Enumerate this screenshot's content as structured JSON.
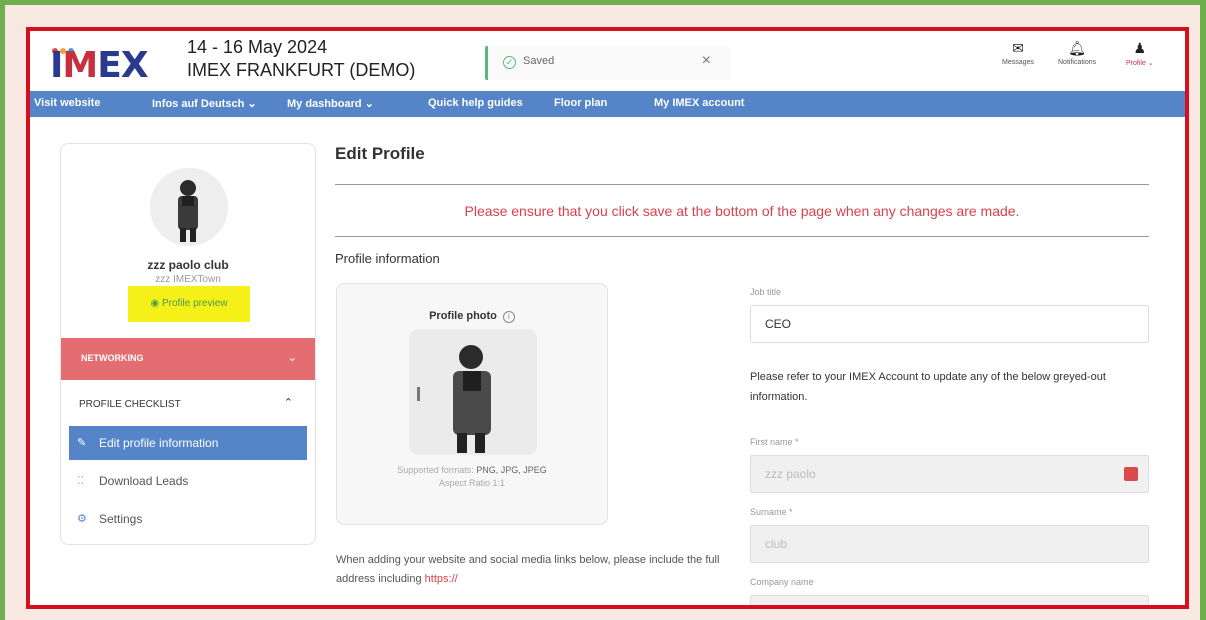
{
  "header": {
    "event_dates": "14 - 16 May 2024",
    "event_name": "IMEX FRANKFURT (DEMO)",
    "logo_text_a": "I",
    "logo_text_b": "M",
    "logo_text_c": "EX",
    "toast": {
      "text": "Saved",
      "close": "×"
    },
    "icons": [
      {
        "name": "envelope-icon",
        "label": "Messages"
      },
      {
        "name": "bell-icon",
        "label": "Notifications"
      },
      {
        "name": "user-icon",
        "label": "Profile ⌄"
      }
    ]
  },
  "nav": {
    "items": [
      "Visit website",
      "Infos auf Deutsch ⌄",
      "My dashboard ⌄",
      "Quick help guides",
      "Floor plan",
      "My IMEX account"
    ]
  },
  "sidebar": {
    "user_name": "zzz paolo club",
    "user_org": "zzz IMEXTown",
    "preview_label": "Profile preview",
    "networking_label": "NETWORKING",
    "checklist_label": "PROFILE CHECKLIST",
    "links": [
      {
        "label": "Edit profile information",
        "icon": "pencil-icon",
        "active": true
      },
      {
        "label": "Download Leads",
        "icon": "grid-icon",
        "active": false
      },
      {
        "label": "Settings",
        "icon": "gear-icon",
        "active": false
      }
    ]
  },
  "main": {
    "title": "Edit Profile",
    "warning": "Please ensure that you click save at the bottom of the page when any changes are made.",
    "section_title": "Profile information",
    "photo": {
      "title": "Profile photo",
      "info": "i",
      "formats_prefix": "Supported formats: ",
      "formats": "PNG, JPG, JPEG",
      "ratio": "Aspect Ratio 1:1"
    },
    "website_note": "When adding your website and social media links below, please include the full address including ",
    "website_link": "https://",
    "job_title_label": "Job title",
    "job_title_value": "CEO",
    "refer_note": "Please refer to your IMEX Account to update any of the below greyed-out information.",
    "first_name_label": "First name *",
    "first_name_value": "zzz paolo",
    "surname_label": "Surname *",
    "surname_value": "club",
    "company_label": "Company name"
  },
  "colors": {
    "nav": "#5585c8",
    "accent_red": "#d9414b",
    "networking": "#e36d71",
    "highlight": "#f5f118",
    "frame_green": "#6fb04c",
    "frame_red": "#d40f1f"
  }
}
